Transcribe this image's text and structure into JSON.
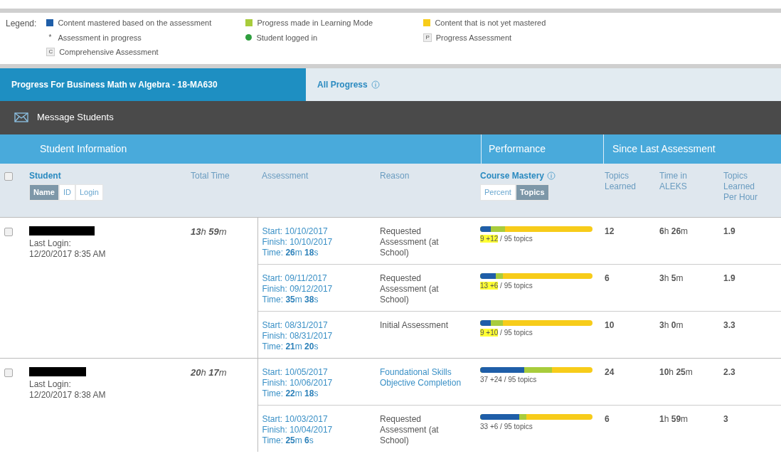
{
  "legend": {
    "label": "Legend:",
    "items": [
      {
        "kind": "square",
        "color": "#1f5ea8",
        "text": "Content mastered based on the assessment"
      },
      {
        "kind": "square",
        "color": "#a8cc3c",
        "text": "Progress made in Learning Mode"
      },
      {
        "kind": "square",
        "color": "#f7cc1a",
        "text": "Content that is not yet mastered"
      },
      {
        "kind": "glyph",
        "glyph": "*",
        "text": "Assessment in progress"
      },
      {
        "kind": "dot",
        "color": "#2e9e3e",
        "text": "Student logged in"
      },
      {
        "kind": "badge",
        "glyph": "P",
        "text": "Progress Assessment"
      },
      {
        "kind": "badge",
        "glyph": "C",
        "text": "Comprehensive Assessment"
      }
    ]
  },
  "tabs": [
    {
      "label": "Progress For Business Math w Algebra - 18-MA630",
      "selected": true,
      "info": false
    },
    {
      "label": "All Progress",
      "selected": false,
      "info": true
    }
  ],
  "toolbar": {
    "message_button": "Message Students"
  },
  "header_groups": [
    "Student Information",
    "Performance",
    "Since Last Assessment"
  ],
  "columns": {
    "select_all_checked": false,
    "student": "Student",
    "student_sort": [
      {
        "label": "Name",
        "selected": true
      },
      {
        "label": "ID",
        "selected": false
      },
      {
        "label": "Login",
        "selected": false
      }
    ],
    "total_time": "Total Time",
    "assessment": "Assessment",
    "reason": "Reason",
    "mastery": "Course Mastery",
    "mastery_mode": [
      {
        "label": "Percent",
        "selected": false
      },
      {
        "label": "Topics",
        "selected": true
      }
    ],
    "topics_learned": "Topics Learned",
    "time_in_aleks": "Time in ALEKS",
    "per_hour": "Topics Learned Per Hour"
  },
  "students": [
    {
      "checked": false,
      "name_redacted": true,
      "last_login_label": "Last Login:",
      "last_login": "12/20/2017 8:35 AM",
      "total_time": "**13**h **59**m",
      "assessments": [
        {
          "start": "Start: 10/10/2017",
          "finish": "Finish: 10/10/2017",
          "time": "Time: **26**m **18**s",
          "reason": "Requested Assessment (at School)",
          "reason_link": false,
          "mastered": {
            "level": 0.095
          },
          "progress": {
            "level": 0.221
          },
          "score": "9 +12",
          "score_highlighted": true,
          "total": "/ 95 topics",
          "topics_learned": "12",
          "time_in_aleks": "**6**h **26**m",
          "per_hour": "1.9"
        },
        {
          "start": "Start: 09/11/2017",
          "finish": "Finish: 09/12/2017",
          "time": "Time: **35**m **38**s",
          "reason": "Requested Assessment (at School)",
          "reason_link": false,
          "mastered": {
            "level": 0.137
          },
          "progress": {
            "level": 0.2
          },
          "score": "13 +6",
          "score_highlighted": true,
          "total": "/ 95 topics",
          "topics_learned": "6",
          "time_in_aleks": "**3**h **5**m",
          "per_hour": "1.9"
        },
        {
          "start": "Start: 08/31/2017",
          "finish": "Finish: 08/31/2017",
          "time": "Time: **21**m **20**s",
          "reason": "Initial Assessment",
          "reason_link": false,
          "mastered": {
            "level": 0.095
          },
          "progress": {
            "level": 0.2
          },
          "score": "9 +10",
          "score_highlighted": true,
          "total": "/ 95 topics",
          "topics_learned": "10",
          "time_in_aleks": "**3**h **0**m",
          "per_hour": "3.3"
        }
      ]
    },
    {
      "checked": false,
      "name_redacted": true,
      "last_login_label": "Last Login:",
      "last_login": "12/20/2017 8:38 AM",
      "total_time": "**20**h **17**m",
      "assessments": [
        {
          "start": "Start: 10/05/2017",
          "finish": "Finish: 10/06/2017",
          "time": "Time: **22**m **18**s",
          "reason": "Foundational Skills Objective Completion",
          "reason_link": true,
          "mastered": {
            "level": 0.39
          },
          "progress": {
            "level": 0.642
          },
          "score": "37 +24",
          "score_highlighted": false,
          "total": "/ 95 topics",
          "topics_learned": "24",
          "time_in_aleks": "**10**h **25**m",
          "per_hour": "2.3"
        },
        {
          "start": "Start: 10/03/2017",
          "finish": "Finish: 10/04/2017",
          "time": "Time: **25**m **6**s",
          "reason": "Requested Assessment (at School)",
          "reason_link": false,
          "mastered": {
            "level": 0.347
          },
          "progress": {
            "level": 0.41
          },
          "score": "33 +6",
          "score_highlighted": false,
          "total": "/ 95 topics",
          "topics_learned": "6",
          "time_in_aleks": "**1**h **59**m",
          "per_hour": "3"
        }
      ]
    }
  ]
}
